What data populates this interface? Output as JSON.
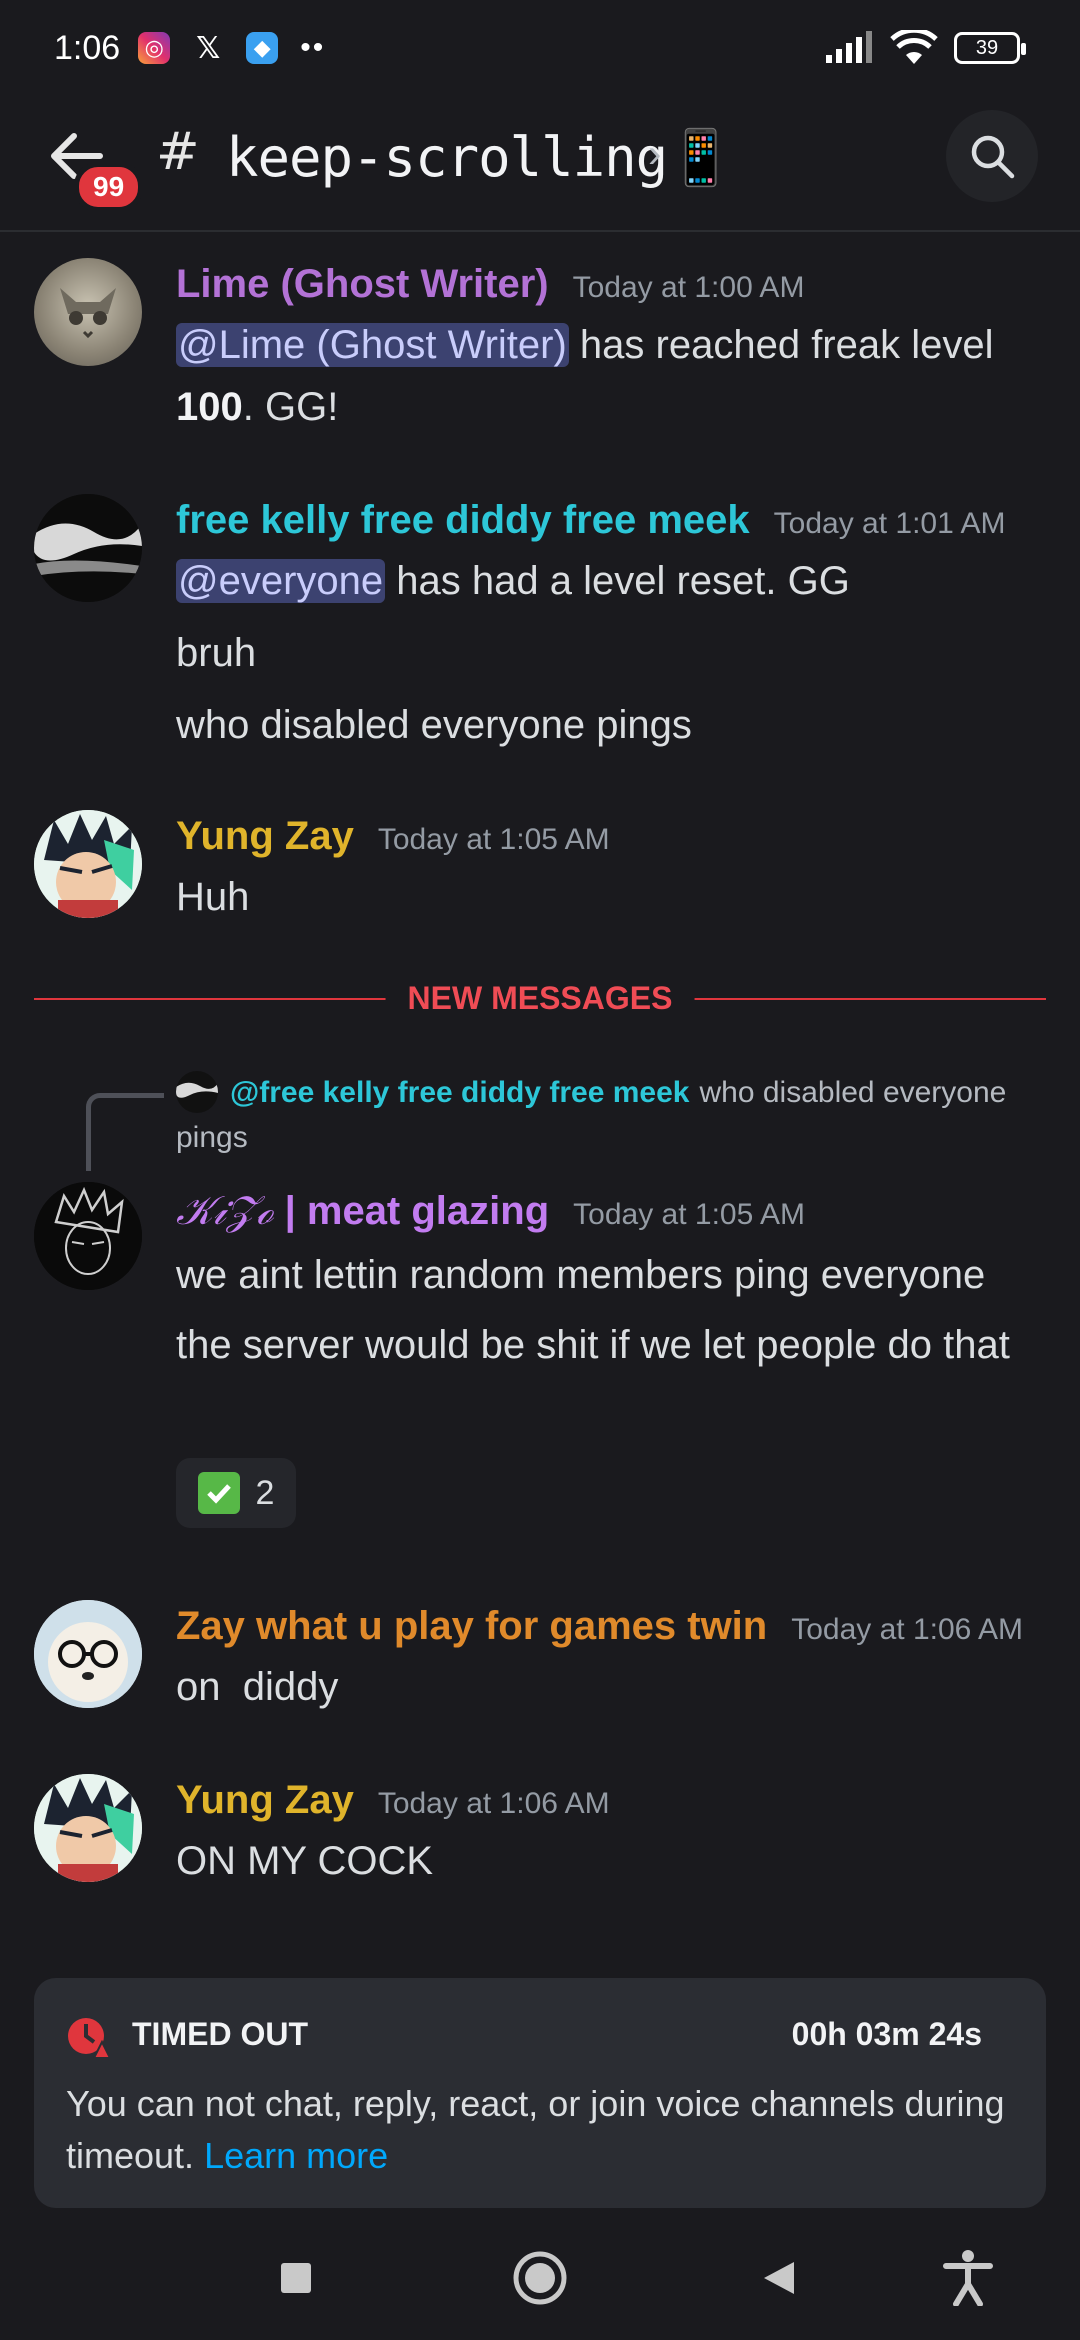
{
  "status_bar": {
    "time": "1:06",
    "apps": [
      "instagram-icon",
      "x-icon",
      "bluesky-icon"
    ],
    "more": "••",
    "battery": "39"
  },
  "header": {
    "unread_count": "99",
    "hash": "#",
    "channel_name": "keep-scrolling📱",
    "chevron": "›"
  },
  "messages": [
    {
      "username": "Lime (Ghost Writer)",
      "user_color": "#b372d6",
      "timestamp": "Today at 1:00 AM",
      "mention": "@Lime (Ghost Writer)",
      "text_after_mention": " has reached freak level ",
      "level": "100",
      "text_end": ". GG!"
    },
    {
      "username": "free kelly free diddy free meek",
      "user_color": "#2dc7d8",
      "timestamp": "Today at 1:01 AM",
      "mention": "@everyone",
      "text_after_mention": " has had a level reset. GG",
      "line2": "bruh",
      "line3": "who disabled everyone pings"
    },
    {
      "username": "Yung Zay",
      "user_color": "#e0b42b",
      "timestamp": "Today at 1:05 AM",
      "text": "Huh"
    },
    {
      "reply_user": "@free kelly free diddy free meek",
      "reply_text": "who disabled everyone pings",
      "username_script": "𝒦𝒾𝒵ℴ",
      "username_sep": " | ",
      "username": "meat glazing",
      "user_color": "#c27cf0",
      "timestamp": "Today at 1:05 AM",
      "line1": "we aint lettin random members ping everyone",
      "line2": "the server would be shit if we let people do that",
      "reaction_count": "2"
    },
    {
      "username": "Zay what u play for games twin",
      "user_color": "#e08a2b",
      "timestamp": "Today at 1:06 AM",
      "text": "on  diddy"
    },
    {
      "username": "Yung Zay",
      "user_color": "#e0b42b",
      "timestamp": "Today at 1:06 AM",
      "text": "ON MY COCK"
    }
  ],
  "divider": {
    "label": "NEW MESSAGES"
  },
  "timeout": {
    "title": "TIMED OUT",
    "timer": "00h 03m 24s",
    "body": "You can not chat, reply, react, or join voice channels during timeout. ",
    "link": "Learn more"
  },
  "colors": {
    "background": "#1a1a1e",
    "mention_bg": "#3c4270",
    "new_messages": "#e0363d",
    "link": "#00a8fc"
  }
}
